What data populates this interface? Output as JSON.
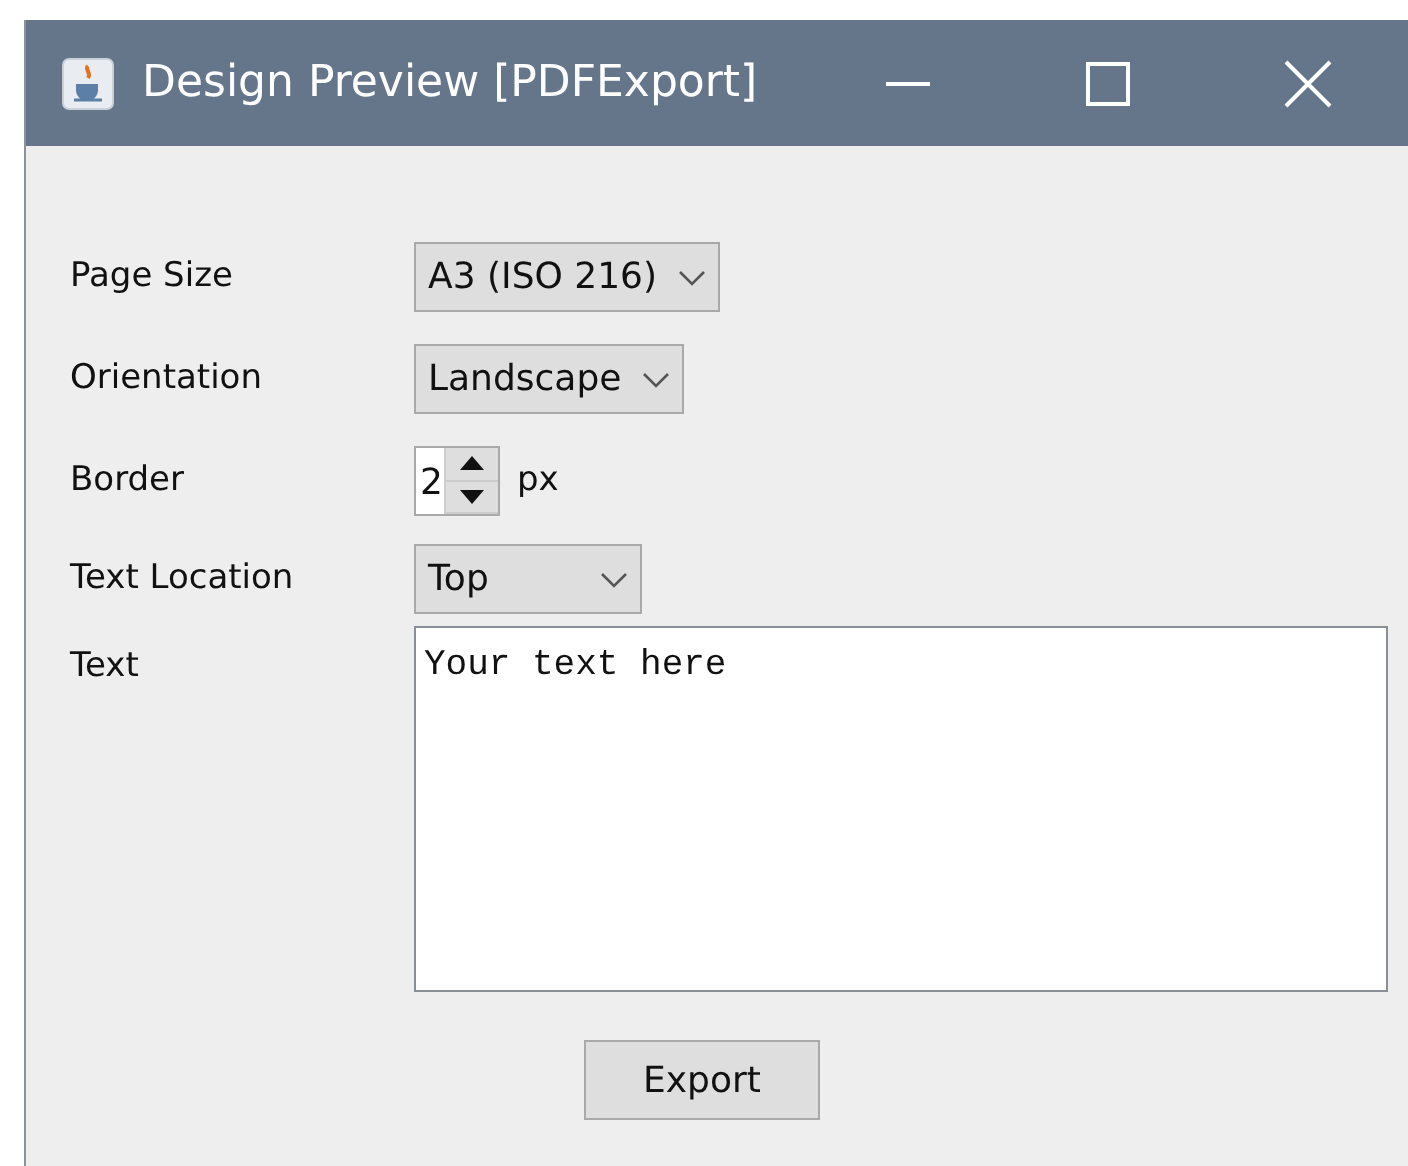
{
  "window": {
    "title": "Design Preview [PDFExport]"
  },
  "fields": [
    {
      "kind": "dropdown",
      "label": "Page Size",
      "value": "A3 (ISO 216)"
    },
    {
      "kind": "dropdown",
      "label": "Orientation",
      "value": "Landscape"
    },
    {
      "kind": "spinner",
      "label": "Border",
      "value": "2",
      "unit": "px"
    },
    {
      "kind": "dropdown",
      "label": "Text Location",
      "value": "Top"
    },
    {
      "kind": "textarea",
      "label": "Text",
      "value": "Your text here"
    }
  ],
  "buttons": [
    "Export"
  ]
}
